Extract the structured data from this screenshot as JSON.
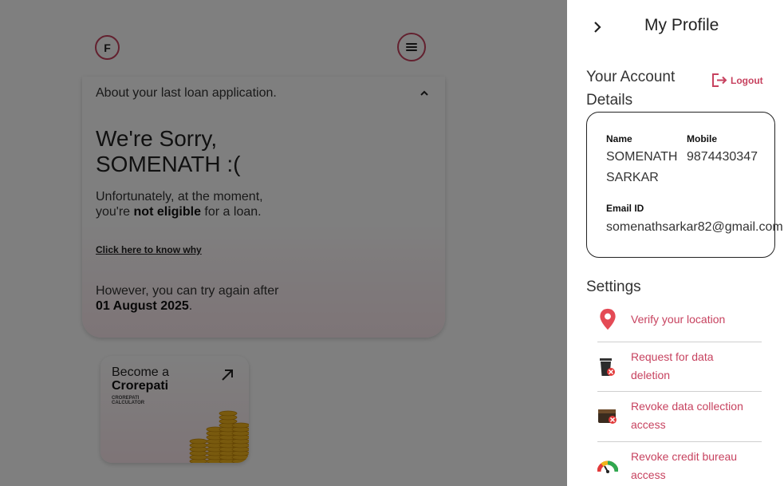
{
  "background": {
    "logo_letter": "F",
    "loan_card": {
      "header": "About your last loan application.",
      "title_line1": "We're Sorry,",
      "title_line2": "SOMENATH :(",
      "message_pre": "Unfortunately, at the moment,",
      "message_you": "you're ",
      "message_bold": "not eligible",
      "message_post": " for a loan.",
      "why_link": "Click here to know why",
      "retry_text": "However, you can try again after",
      "retry_date": "01 August 2025",
      "retry_period": "."
    },
    "promo_card": {
      "line1": "Become a",
      "line2": "Crorepati",
      "brand_line1": "CROREPATI",
      "brand_line2": "CALCULATOR"
    }
  },
  "drawer": {
    "title": "My Profile",
    "account_heading_line1": "Your Account",
    "account_heading_line2": "Details",
    "logout_label": "Logout",
    "account": {
      "name_label": "Name",
      "name_line1": "SOMENATH",
      "name_line2": "SARKAR",
      "mobile_label": "Mobile",
      "mobile_value": "9874430347",
      "email_label": "Email ID",
      "email_value": "somenathsarkar82@gmail.com"
    },
    "settings_heading": "Settings",
    "settings_items": [
      {
        "line1": "Verify your location",
        "line2": "",
        "icon": "location-pin-icon"
      },
      {
        "line1": "Request for data",
        "line2": "deletion",
        "icon": "trash-bin-icon"
      },
      {
        "line1": "Revoke data collection",
        "line2": "access",
        "icon": "wallet-icon"
      },
      {
        "line1": "Revoke credit bureau",
        "line2": "access",
        "icon": "credit-gauge-icon"
      }
    ]
  },
  "colors": {
    "accent": "#c7425f",
    "overlay": "rgba(0,0,0,0.5)"
  }
}
